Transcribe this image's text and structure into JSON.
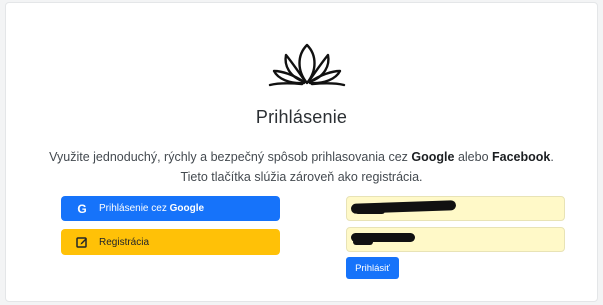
{
  "page": {
    "title": "Prihlásenie",
    "desc_line1_pre": "Využite jednoduchý, rýchly a bezpečný spôsob prihlasovania cez ",
    "desc_google": "Google",
    "desc_mid": " alebo ",
    "desc_facebook": "Facebook",
    "desc_line1_post": ".",
    "desc_line2": "Tieto tlačítka slúžia zároveň ako registrácia."
  },
  "buttons": {
    "google_prefix": "Prihlásenie cez ",
    "google_brand": "Google",
    "google_icon": "google-g-icon",
    "register": "Registrácia",
    "register_icon": "edit-icon",
    "login": "Prihlásiť"
  },
  "form": {
    "email_value": "",
    "password_value": ""
  },
  "colors": {
    "primary": "#1673fa",
    "warning": "#ffc107",
    "autofill": "#fff9c8"
  }
}
